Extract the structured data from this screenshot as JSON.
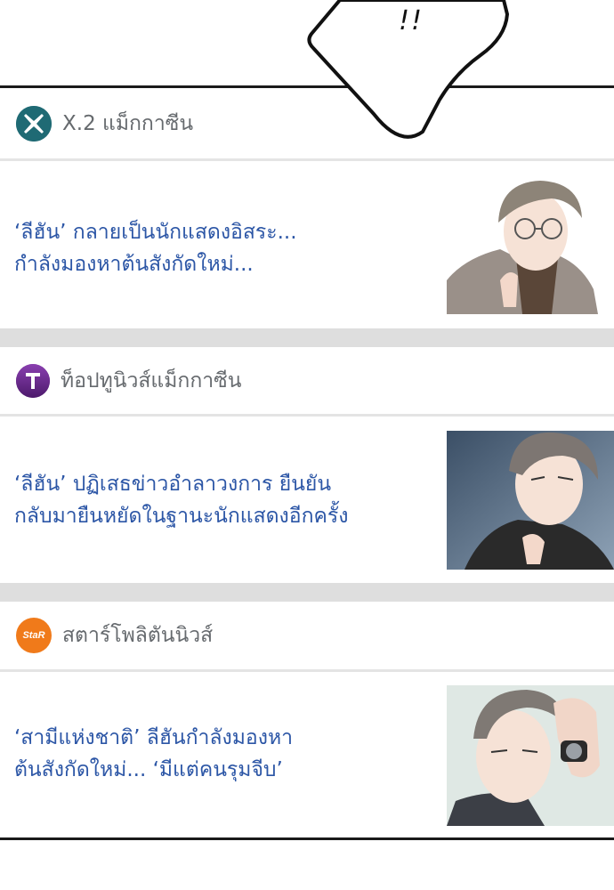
{
  "bubble": {
    "text": "!!"
  },
  "feed": [
    {
      "source": "X.2 แม็กกาซีน",
      "logo_label": "X",
      "logo_color": "#1f6a74",
      "headline": [
        "‘ลีฮัน’ กลายเป็นนักแสดงอิสระ...",
        "กำลังมองหาต้นสังกัดใหม่..."
      ]
    },
    {
      "source": "ท็อปทูนิวส์แม็กกาซีน",
      "logo_label": "T",
      "logo_color": "#6a2a8c",
      "headline": [
        "‘ลีฮัน’ ปฏิเสธข่าวอำลาวงการ ยืนยัน",
        "กลับมายืนหยัดในฐานะนักแสดงอีกครั้ง"
      ]
    },
    {
      "source": "สตาร์โพลิตันนิวส์",
      "logo_label": "StaR",
      "logo_color": "#f07a1a",
      "headline": [
        "‘สามีแห่งชาติ’ ลีฮันกำลังมองหา",
        "ต้นสังกัดใหม่... ‘มีแต่คนรุมจีบ’"
      ]
    }
  ]
}
